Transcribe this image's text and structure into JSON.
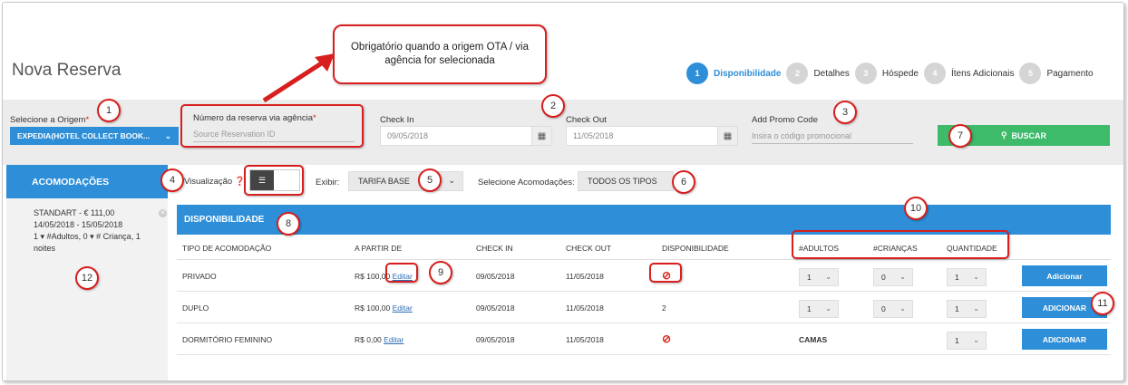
{
  "page": {
    "title": "Nova Reserva"
  },
  "steps": [
    {
      "num": "1",
      "label": "Disponibilidade"
    },
    {
      "num": "2",
      "label": "Detalhes"
    },
    {
      "num": "3",
      "label": "Hóspede"
    },
    {
      "num": "4",
      "label": "Ítens Adicionais"
    },
    {
      "num": "5",
      "label": "Pagamento"
    }
  ],
  "callout": {
    "text": "Obrigatório quando a origem OTA / via agência for selecionada"
  },
  "form": {
    "origem_label": "Selecione a Origem",
    "origem_value": "EXPEDIA(HOTEL COLLECT BOOK...",
    "reserva_label": "Número da reserva via agência",
    "reserva_placeholder": "Source Reservation ID",
    "checkin_label": "Check In",
    "checkin_value": "09/05/2018",
    "checkout_label": "Check Out",
    "checkout_value": "11/05/2018",
    "promo_label": "Add Promo Code",
    "promo_placeholder": "Insira o código promocional",
    "buscar_label": "BUSCAR",
    "required_mark": "*"
  },
  "filters": {
    "visualizacao_label": "Visualização",
    "exibir_label": "Exibir:",
    "exibir_value": "TARIFA BASE",
    "acomodacoes_label": "Selecione Acomodações:",
    "acomodacoes_value": "TODOS OS TIPOS"
  },
  "sidebar": {
    "header": "ACOMODAÇÕES",
    "cart": {
      "title": "STANDART - € 111,00",
      "dates": "14/05/2018 - 15/05/2018",
      "adults_count": "1",
      "adults_label": "#Adultos,",
      "children_count": "0",
      "children_label": "# Criança,",
      "nights_count": "1",
      "nights_label": "noites"
    }
  },
  "disponibilidade": {
    "header": "DISPONIBILIDADE",
    "columns": [
      "TIPO DE ACOMODAÇÃO",
      "A PARTIR DE",
      "CHECK IN",
      "CHECK OUT",
      "DISPONIBILIDADE",
      "#ADULTOS",
      "#CRIANÇAS",
      "QUANTIDADE"
    ],
    "rows": [
      {
        "tipo": "PRIVADO",
        "preco": "R$ 100,00",
        "editar": "Editar",
        "checkin": "09/05/2018",
        "checkout": "11/05/2018",
        "disp": "⊘",
        "adultos": "1",
        "criancas": "0",
        "quantidade": "1",
        "add": "Adicionar"
      },
      {
        "tipo": "DUPLO",
        "preco": "R$ 100,00",
        "editar": "Editar",
        "checkin": "09/05/2018",
        "checkout": "11/05/2018",
        "disp": "2",
        "adultos": "1",
        "criancas": "0",
        "quantidade": "1",
        "add": "ADICIONAR"
      },
      {
        "tipo": "DORMITÓRIO FEMININO",
        "preco": "R$ 0,00",
        "editar": "Editar",
        "checkin": "09/05/2018",
        "checkout": "11/05/2018",
        "disp": "⊘",
        "camas": "CAMAS",
        "quantidade": "1",
        "add": "ADICIONAR"
      }
    ]
  },
  "annotations": [
    "1",
    "2",
    "3",
    "4",
    "5",
    "6",
    "7",
    "8",
    "9",
    "10",
    "11",
    "12"
  ]
}
